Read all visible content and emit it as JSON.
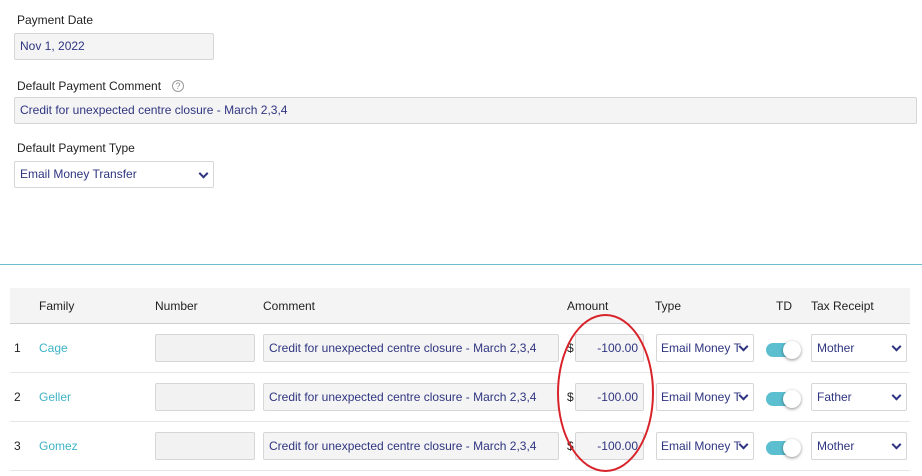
{
  "payment_date": {
    "label": "Payment Date",
    "value": "Nov 1, 2022"
  },
  "default_comment": {
    "label": "Default Payment Comment",
    "help_icon": "?",
    "value": "Credit for unexpected centre closure - March 2,3,4"
  },
  "default_type": {
    "label": "Default Payment Type",
    "value": "Email Money Transfer"
  },
  "table": {
    "headers": {
      "family": "Family",
      "number": "Number",
      "comment": "Comment",
      "amount": "Amount",
      "type": "Type",
      "td": "TD",
      "tax_receipt": "Tax Receipt"
    },
    "currency_symbol": "$",
    "rows": [
      {
        "index": "1",
        "family": "Cage",
        "number": "",
        "comment": "Credit for unexpected centre closure - March 2,3,4",
        "amount": "-100.00",
        "type": "Email Money T",
        "td": true,
        "tax_receipt": "Mother"
      },
      {
        "index": "2",
        "family": "Geller",
        "number": "",
        "comment": "Credit for unexpected centre closure - March 2,3,4",
        "amount": "-100.00",
        "type": "Email Money T",
        "td": true,
        "tax_receipt": "Father"
      },
      {
        "index": "3",
        "family": "Gomez",
        "number": "",
        "comment": "Credit for unexpected centre closure - March 2,3,4",
        "amount": "-100.00",
        "type": "Email Money T",
        "td": true,
        "tax_receipt": "Mother"
      }
    ]
  },
  "colors": {
    "accent": "#3fb3c6",
    "field_text": "#2f3580",
    "annotation": "#d8232a",
    "toggle_on": "#5bbfd0"
  }
}
